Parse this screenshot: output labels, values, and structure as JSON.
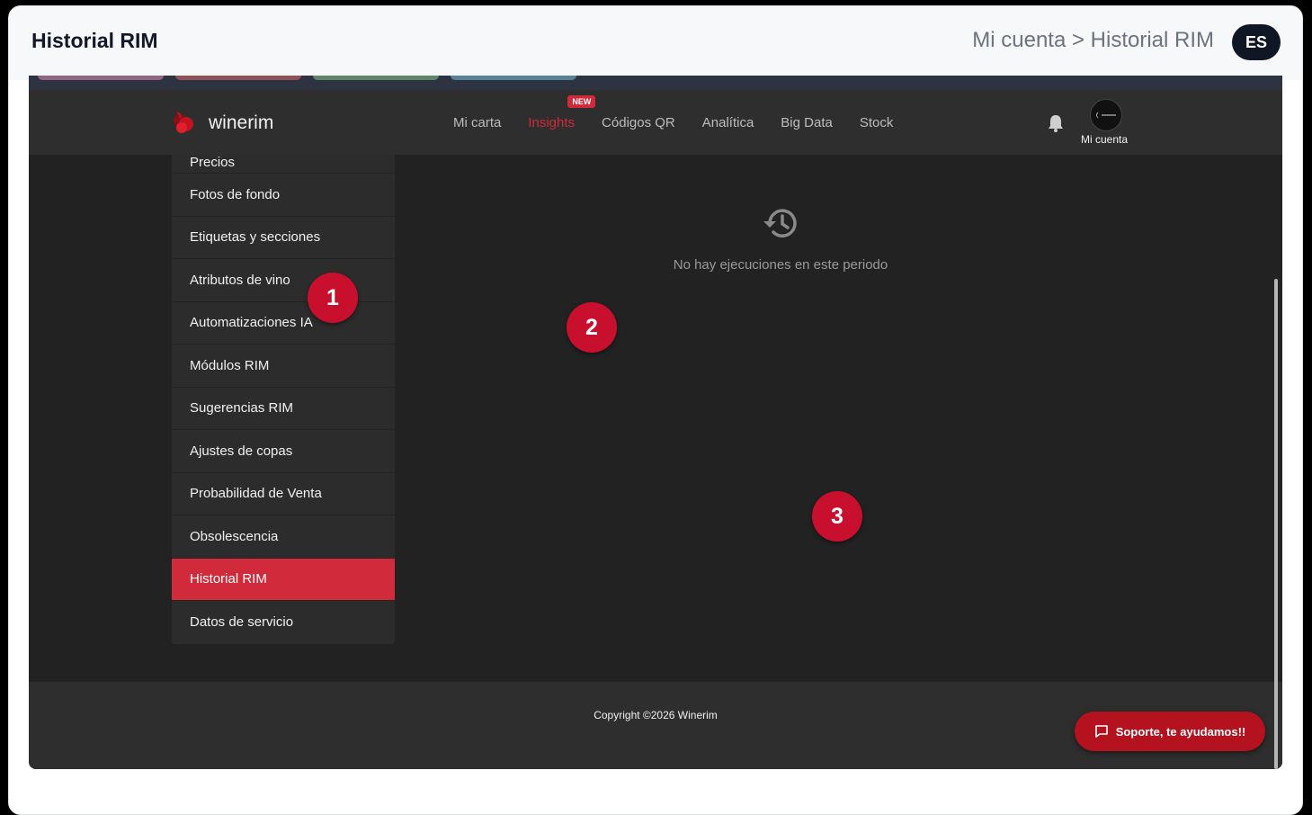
{
  "header": {
    "title": "Historial RIM",
    "breadcrumb": "Mi cuenta > Historial RIM",
    "language": "ES"
  },
  "app": {
    "logo_text": "winerim",
    "nav": [
      {
        "label": "Mi carta",
        "active": false
      },
      {
        "label": "Insights",
        "active": true,
        "badge": "NEW"
      },
      {
        "label": "Códigos QR",
        "active": false
      },
      {
        "label": "Analítica",
        "active": false
      },
      {
        "label": "Big Data",
        "active": false
      },
      {
        "label": "Stock",
        "active": false
      }
    ],
    "account_label": "Mi cuenta",
    "sidebar": [
      {
        "label": "Precios"
      },
      {
        "label": "Fotos de fondo"
      },
      {
        "label": "Etiquetas y secciones"
      },
      {
        "label": "Atributos de vino"
      },
      {
        "label": "Automatizaciones IA"
      },
      {
        "label": "Módulos RIM"
      },
      {
        "label": "Sugerencias RIM"
      },
      {
        "label": "Ajustes de copas"
      },
      {
        "label": "Probabilidad de Venta"
      },
      {
        "label": "Obsolescencia"
      },
      {
        "label": "Historial RIM",
        "active": true
      },
      {
        "label": "Datos de servicio"
      }
    ],
    "empty_state": {
      "icon": "history-icon",
      "message": "No hay ejecuciones en este periodo"
    },
    "footer": {
      "copyright": "Copyright ©2026 Winerim",
      "support_label": "Soporte, te ayudamos!!"
    }
  },
  "markers": [
    "1",
    "2",
    "3"
  ],
  "colors": {
    "accent": "#d12a3a",
    "marker": "#c8102e",
    "background": "#222222",
    "navbar": "#2e2e2e"
  }
}
